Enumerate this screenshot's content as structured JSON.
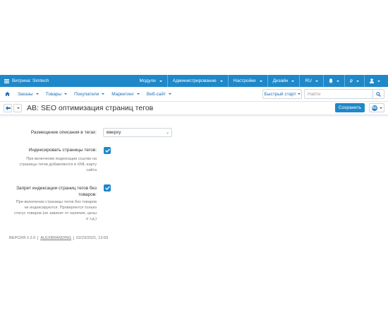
{
  "topbar": {
    "storefront": "Витрина: Simtech",
    "menu": [
      "Модули",
      "Администрирование",
      "Настройки",
      "Дизайн"
    ],
    "language": "RU",
    "currency": "₽"
  },
  "navbar": {
    "items": [
      "Заказы",
      "Товары",
      "Покупатели",
      "Маркетинг",
      "Веб-сайт"
    ],
    "quick_start": "Быстрый старт",
    "search_placeholder": "Найти"
  },
  "titlebar": {
    "title": "AB: SEO оптимизация страниц тегов",
    "save": "Сохранить",
    "addon_icon_letter": "Ab"
  },
  "form": {
    "placement_label": "Размещение описания в тегах:",
    "placement_value": "вверху",
    "index_label": "Индексировать страницы тегов:",
    "index_desc": [
      "При включении индексации ссылки на",
      "страницы тегов добавляются в XML-карту",
      "сайта"
    ],
    "noindex_label": [
      "Запрет индексации страниц тегов без",
      "товаров:"
    ],
    "noindex_desc": [
      "При включении страницы тегов без товаров",
      "не индексируются. Проверяется только",
      "статус товаров (не зависит от наличия, цены",
      "и т.д.)"
    ]
  },
  "footer": {
    "version": "ВЕРСИЯ 2.2.0",
    "author": "ALEXBRANDING",
    "date": "02/23/2021, 13:59"
  },
  "colors": {
    "primary": "#1e88c9",
    "link": "#1f6fb2"
  }
}
